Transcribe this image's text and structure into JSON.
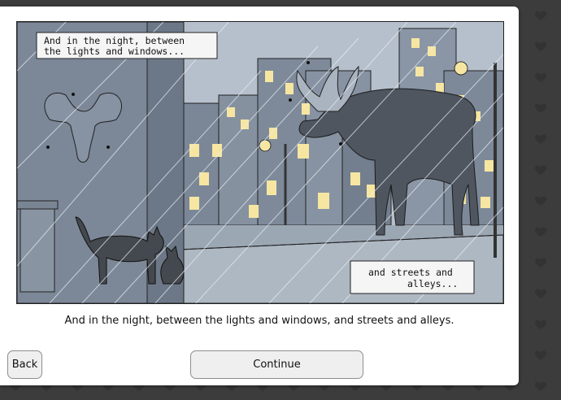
{
  "comic": {
    "bubble_top_line1": "And in the night, between",
    "bubble_top_line2": "the lights and windows...",
    "bubble_bottom_line1": "and streets and",
    "bubble_bottom_line2": "alleys..."
  },
  "caption": "And in the night, between the lights and windows, and streets and alleys.",
  "buttons": {
    "back_label": "Back",
    "continue_label": "Continue"
  }
}
